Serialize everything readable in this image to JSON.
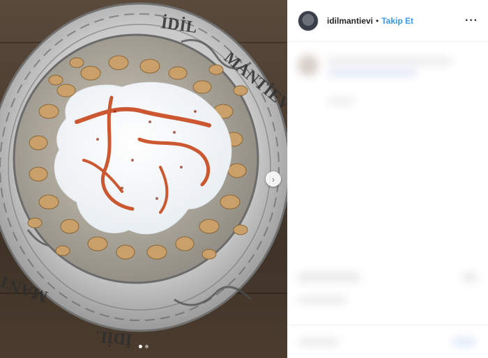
{
  "post": {
    "photo": {
      "plate_inscription_top": "IDIL MANTIEVI",
      "plate_inscription_bottom": "IDIL MANTI",
      "carousel_dots": 2,
      "active_dot": 0
    }
  },
  "header": {
    "username": "idilmantievi",
    "separator": "•",
    "follow_label": "Takip Et",
    "more_label": "···"
  },
  "colors": {
    "follow": "#3897f0",
    "text": "#262626",
    "divider": "#efefef"
  },
  "icons": {
    "next": "chevron-right-icon",
    "more": "more-horizontal-icon"
  }
}
